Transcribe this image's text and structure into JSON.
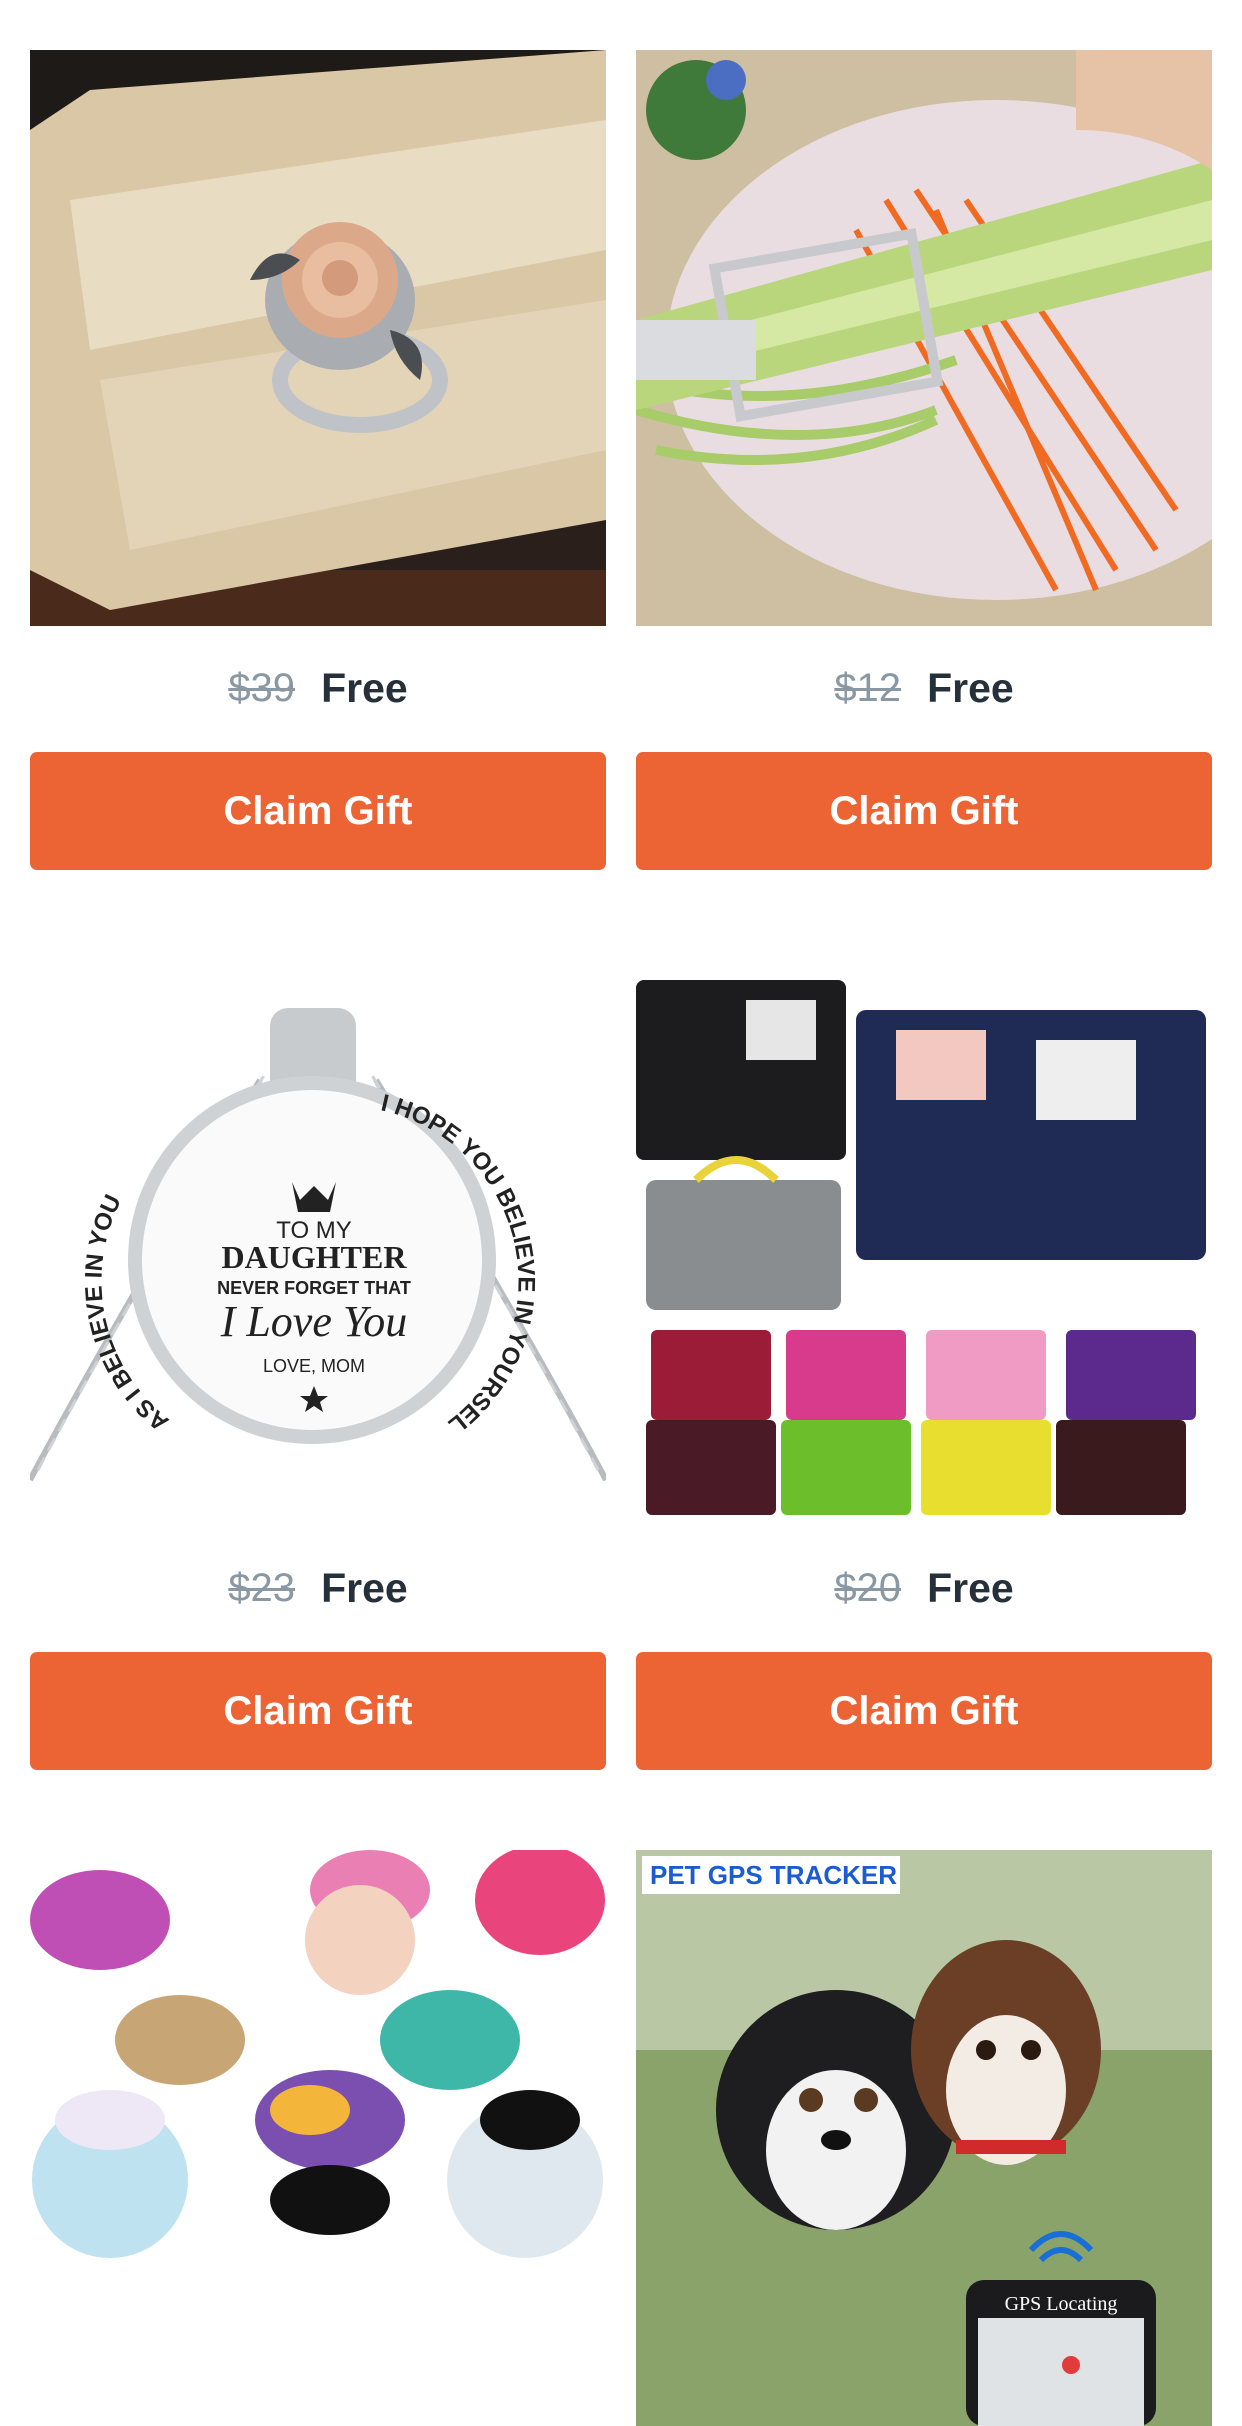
{
  "products": [
    {
      "image_icon": "rose-ring-photo",
      "old_price": "$39",
      "new_price": "Free",
      "button_label": "Claim Gift"
    },
    {
      "image_icon": "vegetable-peeler-photo",
      "old_price": "$12",
      "new_price": "Free",
      "button_label": "Claim Gift"
    },
    {
      "image_icon": "daughter-necklace-photo",
      "old_price": "$23",
      "new_price": "Free",
      "button_label": "Claim Gift",
      "engraving": {
        "arc_left": "AS I BELIEVE IN YOU",
        "arc_right": "I HOPE YOU BELIEVE IN YOURSELF AS MUCH",
        "line1": "TO MY",
        "line2": "DAUGHTER",
        "line3": "NEVER FORGET THAT",
        "line4": "I Love You",
        "line5": "LOVE, MOM"
      }
    },
    {
      "image_icon": "organizer-bags-photo",
      "old_price": "$20",
      "new_price": "Free",
      "button_label": "Claim Gift"
    },
    {
      "image_icon": "hair-bows-photo"
    },
    {
      "image_icon": "pet-gps-tracker-photo",
      "banner": "PET GPS TRACKER",
      "phone_label": "GPS Locating"
    }
  ],
  "colors": {
    "button": "#ec6434",
    "old_price": "#8a98a3",
    "new_price": "#25303a"
  }
}
